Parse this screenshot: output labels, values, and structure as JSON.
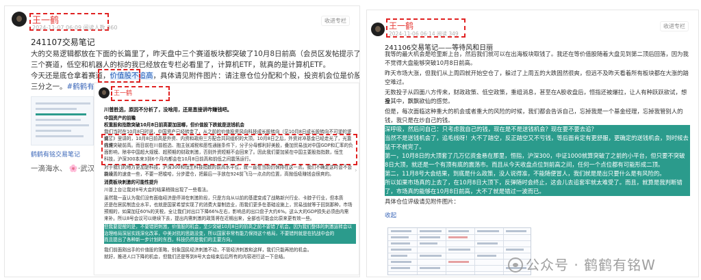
{
  "left_post": {
    "author": "王一鹤",
    "meta": "2024-11-07 06:09  阅读人数 360",
    "follow": "收进专栏",
    "title": "241107交易笔记",
    "lines": [
      "大的交易逻辑都放在下面的长篇里了，昨天盘中三个赛道板块都突破了10月8日前高（会员区发帖提示了），所以我加了",
      "三个赛道，低空和机器人的标的我已经放在专栏必看里了，计算机ETF，就真的是计算机ETF。",
      "今天还是底仓拿着赛道，",
      "价值股不追高",
      "，具体请见附件图片：请注意仓位分配和个股，投资机会位是价股仓位同样评级的",
      "三分之一。",
      "#鹤鹤有铭交易笔记"
    ],
    "thumb_caption": "鹤鹤有铭交易笔记",
    "bottom_tags": "一滴海水、 🌸·武汉..."
  },
  "inner_post": {
    "author": "王一鹤",
    "subtitle": "川普胜选，原因不分析了，没啥用，还是直接讲咋赚钱吧。",
    "paras": [
      "中国资产的前瞻",
      "权重股和指数突破10月8日前高要加固哪，但价值股下跌就是送钱机会",
      "我们当时在10月8日时说，中国资产已经转变了，从之前的价值投资风向科技成长股转向（见10月8日成长股转向不可逆的逻辑）。",
      "变了》里讲的，10月8日前高是外资、内资和政府三方配合共同组织的大顶。10月8日之后，外资对冲基金已经走光了，光靠内资",
      "很难突破前高。而目前在川普胜选、抱主张减税和恶性通胀条件下，分子分母都利好美股，叠加贸易战对中国GDP和汇率的负",
      "面影响，除非中国超大规模、超预期的财政刺激，否则外资短期不会回来了。因此我们要加紧在中国主要股指指数，恒生",
      "科技，沪深300本来3到6个月内都会在10月8日前高和前低之间震荡运行。",
      "对于我们的地方更加是科技，沪深300和恒生科技指数的前高水平位，就一直在当前仍保持在这一点。我们不确定这时会不会持续",
      "能设置的速查一些，不要一把梭哈，分步建仓，把最后一手放在924前飞马一点点的位置，高抛低吸赚钱会很爽的。",
      "消费板块刺激的可能性提升",
      "川普上台让我对8号大会的结果稍微出现了一些看法。",
      "虽然我一直认为我们没有面临经济是停滞在刺激阶段，只是方向从以前的基建变成了战略新兴行业、卡脖子行业，但本质",
      "还是在居民制造业水平，也就是国家希望实现了的消费大量制造业，而我们更多在基础设施上，贸易战就等于回到那种，市场",
      "预期的，如果加征60%的关税，全让我们对出口下降66%左右，影响总的出口盘子大约6%。这么大的GDP损失必须由内需",
      "来补。所以8号会议可以继续下去，提出内需刺激的政策将在近期出来，全部也可能会比原来更有效一些。",
      "但我要提醒的是，不要错把刺激，价值股的机会，至少突破10月8日的前高之前不要错了机会。因为我们整体的刺激运转会以",
      "治理格局深层实践深化改革，中美对抗的思路没变，所以国家非常有能力保持这个格局，不要错判就是在抗战中会的",
      "而且提出了各种新一步计划的东西，科技仍然是我们的主要方向。",
      "我们前面刚出手的价值股的策略，别象国民经济刺激不动，不管经济刺激和这样，我们只能再抢的机会。",
      "就好，推进人口下降的机会，但我们还是等到8号大会结束后后所有的内容进行这一下总结。"
    ]
  },
  "right_post": {
    "author": "王一鹤",
    "meta": "2024-11-06 06:14  阅读 349",
    "follow": "收进专栏",
    "title": "241106交易笔记——等待风和日丽",
    "paras": [
      "我等的最大机会是哈里斯上台，然后我们就可以在出海板块取钱了。我还在等价值股随着大盘见到第二顶后回落，因为我",
      "不觉得大盘能够突破10月8日前高。",
      "昨天市场大涨，但我们从上周四就开始空仓了，躲过了上周五的大跌固然很爽，但远不及昨天看着所有板块都在大涨的踏",
      "空难过。",
      "无数投子从四面八方传来，财政政策、低空政策，重组消息，甚至在A股收盘后，恒指还被爆拉，让人有种跃跃欲试，想投",
      "身其中，飘飘欲仙的感觉。",
      "但是，每次面临这种重大的机会或者重大的风险的时候，我们都会告诉自己，忘掉我是一个基金经理，忘掉我管别人的",
      "钱，我只是在炒自己的钱。",
      "深呼吸，然后问自己：只考虑我自己的钱，现在是不是送钱机会？现在要不要去追？",
      "当然不是送钱机会了，追毛线呀！大不了踏空，反正踏空又不亏钱，等后面肯定有更舒服，更确定的送钱机会，到时候去",
      "猛干不就完了。",
      "第一，10月8日的大顶套了几万亿资金悬在那里，恒指，沪深300，中证1000就算突破了之前的小平台，但只要不突破10月",
      "8日大顶，就还是一个有顶有底的震荡市。而且从今天收盘点位到前高之间，任何一个点位都有可能形成二顶。",
      "第二，11月8号大会结果，到底是什么政策，没人说得准，不能随便冒人，我们就是是出只要什么是有风险的。",
      "所以如果市场真的上去了，在10月8日大顶下，反弹随时会终止，这会儿去追套牢就太难受了。而且，就算是我判断错",
      "了，市场真的能够在10月8日前高，大不了就是错过一波而已。",
      "具体仓位评级请见附件图片："
    ],
    "link": "收起"
  },
  "watermark": "公众号 · 鹤鹤有铭W",
  "colors": {
    "author_red": "#e53935",
    "highlight_teal": "#2b9b8c",
    "link_blue": "#3a66b8",
    "dashed_red": "#e02020"
  }
}
